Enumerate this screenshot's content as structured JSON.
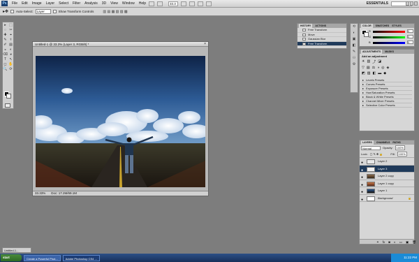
{
  "menubar": {
    "logo": "Ps",
    "items": [
      "File",
      "Edit",
      "Image",
      "Layer",
      "Select",
      "Filter",
      "Analysis",
      "3D",
      "View",
      "Window",
      "Help"
    ],
    "zoom": "33.3",
    "workspace": "ESSENTIALS"
  },
  "options": {
    "auto_select_label": "Auto-Select:",
    "auto_select_value": "Layer",
    "show_transform_label": "Show Transform Controls"
  },
  "tools": [
    "▸",
    "⬚",
    "◌",
    "✂",
    "✚",
    "⌖",
    "✎",
    "⚕",
    "✐",
    "▤",
    "◒",
    "◐",
    "⌫",
    "◕",
    "T",
    "↖",
    "◻",
    "✋",
    "🔍",
    "⟳"
  ],
  "document": {
    "title": "Untitled-1 @ 33.3% (Layer 3, RGB/8) *",
    "status_zoom": "33.33%",
    "status_doc": "Doc: 17.2M/69.1M"
  },
  "history": {
    "tabs": [
      "HISTORY",
      "ACTIONS"
    ],
    "items": [
      "Free Transform",
      "Move",
      "Gaussian Blur",
      "Free Transform"
    ],
    "selected_index": 3
  },
  "color_panel": {
    "tabs": [
      "COLOR",
      "SWATCHES",
      "STYLES"
    ],
    "channels": [
      {
        "label": "R",
        "value": "0"
      },
      {
        "label": "G",
        "value": "0"
      },
      {
        "label": "B",
        "value": "0"
      }
    ]
  },
  "adjustments": {
    "tabs": [
      "ADJUSTMENTS",
      "MASKS"
    ],
    "heading": "Add an adjustment",
    "presets": [
      "Levels Presets",
      "Curves Presets",
      "Exposure Presets",
      "Hue/Saturation Presets",
      "Black & White Presets",
      "Channel Mixer Presets",
      "Selective Color Presets"
    ]
  },
  "layers": {
    "tabs": [
      "LAYERS",
      "CHANNELS",
      "PATHS"
    ],
    "blend_mode": "Normal",
    "opacity_label": "Opacity:",
    "opacity": "100%",
    "lock_label": "Lock:",
    "fill_label": "Fill:",
    "fill": "100%",
    "items": [
      "Layer 2",
      "Layer 3",
      "Layer 2 copy",
      "Layer 1 copy",
      "Layer 1",
      "Background"
    ],
    "selected_index": 1
  },
  "minimized_doc": "Untitled-1...",
  "taskbar": {
    "start": "start",
    "tasks": [
      "Create a Powerful Phot...",
      "Adobe Photoshop CS4 ..."
    ],
    "active_index": 1,
    "clock": "11:22 PM"
  }
}
